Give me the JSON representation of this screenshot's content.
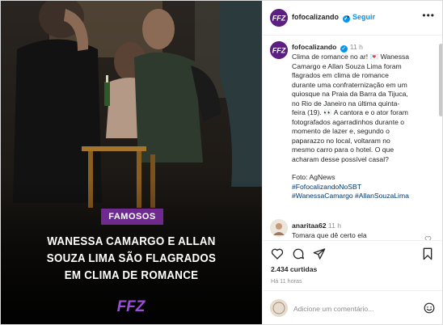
{
  "account": {
    "username": "fofocalizando",
    "follow_label": "Seguir",
    "more_label": "•••"
  },
  "photo": {
    "badge": "FAMOSOS",
    "headline_lines": [
      "WANESSA CAMARGO E ALLAN",
      "SOUZA LIMA SÃO FLAGRADOS",
      "EM CLIMA DE ROMANCE"
    ],
    "logo_text": "FFZ"
  },
  "caption": {
    "username": "fofocalizando",
    "time": "11 h",
    "lines": [
      "Clima de romance no ar! 💌 Wanessa",
      "Camargo e Allan Souza Lima foram",
      "flagrados em clima de romance",
      "durante uma confraternização em um",
      "quiosque na Praia da Barra da Tijuca,",
      "no Rio de Janeiro na última quinta-",
      "feira (19). 👀 A cantora e o ator foram",
      "fotografados agarradinhos durante o",
      "momento de lazer e, segundo o",
      "paparazzo no local, voltaram no",
      "mesmo carro para o hotel. O que",
      "acharam desse possível casal?"
    ],
    "photo_credit": "Foto: AgNews",
    "hashtags_line1": "#FofocalizandoNoSBT",
    "hashtags_line2": "#WanessaCamargo #AllanSouzaLima"
  },
  "comment": {
    "username": "anaritaa62",
    "time": "11 h",
    "text": "Tomara que dê certo ela"
  },
  "footer": {
    "likes_count": "2.434",
    "likes_label": "curtidas",
    "posted": "Há 11 horas",
    "add_comment_placeholder": "Adicione um comentário..."
  },
  "colors": {
    "accent": "#0095f6",
    "brand": "#6e2a8f",
    "link": "#00376b"
  },
  "icons": [
    "heart-icon",
    "comment-icon",
    "share-icon",
    "bookmark-icon",
    "emoji-icon",
    "verified-icon",
    "more-icon"
  ]
}
